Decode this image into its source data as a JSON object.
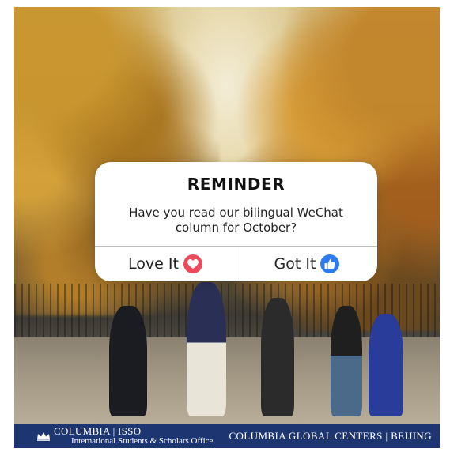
{
  "dialog": {
    "title": "REMINDER",
    "message": "Have you read our bilingual WeChat column for October?",
    "actions": [
      {
        "label": "Love It",
        "icon": "heart-icon",
        "icon_color": "#ef4a5c"
      },
      {
        "label": "Got It",
        "icon": "thumbs-up-icon",
        "icon_color": "#2d7bf0"
      }
    ]
  },
  "banner": {
    "left_title": "COLUMBIA | ISSO",
    "left_subtitle": "International Students & Scholars Office",
    "right_title": "COLUMBIA GLOBAL CENTERS | BEIJING",
    "background": "#1d3672",
    "logo_icon": "crown-icon"
  }
}
